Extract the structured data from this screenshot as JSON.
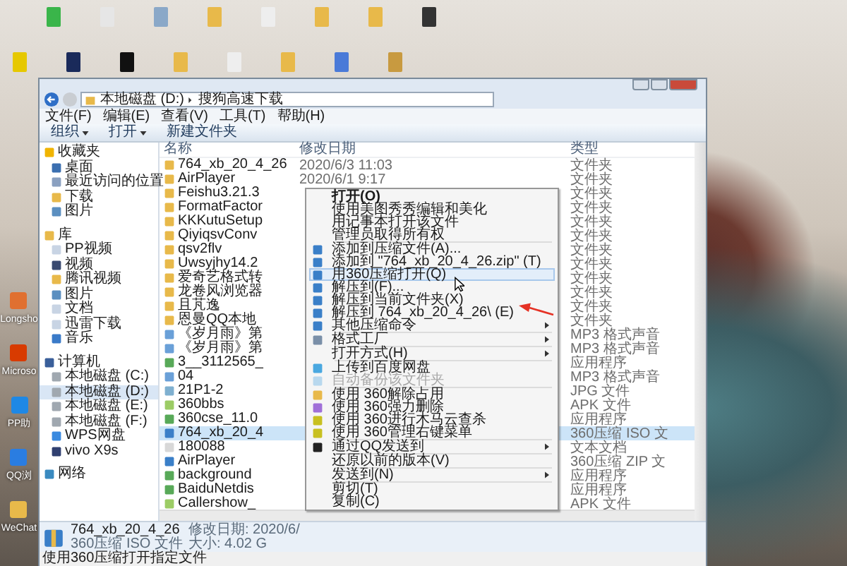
{
  "desktop": {
    "side_icons": [
      {
        "label": "Longsho"
      },
      {
        "label": "Microso"
      },
      {
        "label": "PP助"
      },
      {
        "label": "QQ浏"
      },
      {
        "label": "WeChat"
      }
    ]
  },
  "window": {
    "address": [
      "本地磁盘 (D:)",
      "搜狗高速下载"
    ],
    "menu": [
      "文件(F)",
      "编辑(E)",
      "查看(V)",
      "工具(T)",
      "帮助(H)"
    ],
    "toolbar": [
      {
        "label": "组织",
        "dropdown": true
      },
      {
        "label": "打开",
        "dropdown": true
      },
      {
        "label": "新建文件夹",
        "dropdown": false
      }
    ],
    "sidebar": [
      {
        "label": "收藏夹",
        "selected": false,
        "children": [
          {
            "label": "桌面",
            "selected": false
          },
          {
            "label": "最近访问的位置",
            "selected": false
          },
          {
            "label": "下载",
            "selected": false
          },
          {
            "label": "图片",
            "selected": false
          }
        ]
      },
      {
        "label": "库",
        "selected": false,
        "children": [
          {
            "label": "PP视频",
            "selected": false
          },
          {
            "label": "视频",
            "selected": false
          },
          {
            "label": "腾讯视频",
            "selected": false
          },
          {
            "label": "图片",
            "selected": false
          },
          {
            "label": "文档",
            "selected": false
          },
          {
            "label": "迅雷下载",
            "selected": false
          },
          {
            "label": "音乐",
            "selected": false
          }
        ]
      },
      {
        "label": "计算机",
        "selected": false,
        "children": [
          {
            "label": "本地磁盘 (C:)",
            "selected": false
          },
          {
            "label": "本地磁盘 (D:)",
            "selected": true
          },
          {
            "label": "本地磁盘 (E:)",
            "selected": false
          },
          {
            "label": "本地磁盘 (F:)",
            "selected": false
          },
          {
            "label": "WPS网盘",
            "selected": false
          },
          {
            "label": "vivo X9s",
            "selected": false
          }
        ]
      },
      {
        "label": "网络",
        "selected": false
      }
    ],
    "columns": [
      "名称",
      "修改日期",
      "类型"
    ],
    "files": [
      {
        "name": "764_xb_20_4_26",
        "date": "2020/6/3 11:03",
        "type": "文件夹",
        "kind": "folder",
        "selected": false
      },
      {
        "name": "AirPlayer",
        "date": "2020/6/1 9:17",
        "type": "文件夹",
        "kind": "folder",
        "selected": false
      },
      {
        "name": "Feishu3.21.3",
        "type": "文件夹",
        "kind": "folder",
        "selected": false
      },
      {
        "name": "FormatFactor",
        "type": "文件夹",
        "kind": "folder",
        "selected": false
      },
      {
        "name": "KKKutuSetup",
        "type": "文件夹",
        "kind": "folder",
        "selected": false
      },
      {
        "name": "QiyiqsvConv",
        "type": "文件夹",
        "kind": "folder",
        "selected": false
      },
      {
        "name": "qsv2flv",
        "type": "文件夹",
        "kind": "folder",
        "selected": false
      },
      {
        "name": "Uwsyjhy14.2",
        "type": "文件夹",
        "kind": "folder",
        "selected": false
      },
      {
        "name": "爱奇艺格式转",
        "type": "文件夹",
        "kind": "folder",
        "selected": false
      },
      {
        "name": "龙卷风浏览器",
        "type": "文件夹",
        "kind": "folder",
        "selected": false
      },
      {
        "name": "且芃逸",
        "type": "文件夹",
        "kind": "folder",
        "selected": false
      },
      {
        "name": "恩曼QQ本地",
        "type": "文件夹",
        "kind": "folder",
        "selected": false
      },
      {
        "name": "《岁月雨》第",
        "type": "MP3 格式声音",
        "kind": "audio",
        "selected": false
      },
      {
        "name": "《岁月雨》第",
        "type": "MP3 格式声音",
        "kind": "audio",
        "selected": false
      },
      {
        "name": "3__3112565_",
        "type": "应用程序",
        "kind": "app",
        "selected": false
      },
      {
        "name": "04",
        "type": "MP3 格式声音",
        "kind": "audio",
        "selected": false
      },
      {
        "name": "21P1-2",
        "type": "JPG 文件",
        "kind": "image",
        "selected": false
      },
      {
        "name": "360bbs",
        "type": "APK 文件",
        "kind": "apk",
        "selected": false
      },
      {
        "name": "360cse_11.0",
        "type": "应用程序",
        "kind": "app",
        "selected": false
      },
      {
        "name": "764_xb_20_4",
        "type": "360压缩 ISO 文",
        "kind": "archive",
        "selected": true
      },
      {
        "name": "180088",
        "type": "文本文档",
        "kind": "text",
        "selected": false
      },
      {
        "name": "AirPlayer",
        "type": "360压缩 ZIP 文",
        "kind": "archive",
        "selected": false
      },
      {
        "name": "background",
        "type": "应用程序",
        "kind": "app",
        "selected": false
      },
      {
        "name": "BaiduNetdis",
        "type": "应用程序",
        "kind": "app",
        "selected": false
      },
      {
        "name": "Callershow_",
        "type": "APK 文件",
        "kind": "apk",
        "selected": false
      }
    ],
    "details": {
      "name": "764_xb_20_4_26",
      "type": "360压缩 ISO 文件",
      "date": "修改日期: 2020/6/",
      "size": "大小: 4.02 G"
    },
    "status": "使用360压缩打开指定文件"
  },
  "context_menu": [
    {
      "kind": "item",
      "label": "打开(O)",
      "bold": true,
      "submenu": false,
      "disabled": false,
      "selected": false
    },
    {
      "kind": "item",
      "label": "使用美图秀秀编辑和美化",
      "bold": false,
      "submenu": false,
      "disabled": false,
      "selected": false
    },
    {
      "kind": "item",
      "label": "用记事本打开该文件",
      "bold": false,
      "submenu": false,
      "disabled": false,
      "selected": false
    },
    {
      "kind": "item",
      "label": "管理员取得所有权",
      "bold": false,
      "submenu": false,
      "disabled": false,
      "selected": false
    },
    {
      "kind": "separator"
    },
    {
      "kind": "item",
      "label": "添加到压缩文件(A)...",
      "bold": false,
      "submenu": false,
      "disabled": false,
      "selected": false
    },
    {
      "kind": "item",
      "label": "添加到 \"764_xb_20_4_26.zip\" (T)",
      "bold": false,
      "submenu": false,
      "disabled": false,
      "selected": false
    },
    {
      "kind": "item",
      "label": "用360压缩打开(Q)",
      "bold": false,
      "submenu": false,
      "disabled": false,
      "selected": true
    },
    {
      "kind": "item",
      "label": "解压到(F)...",
      "bold": false,
      "submenu": false,
      "disabled": false,
      "selected": false
    },
    {
      "kind": "item",
      "label": "解压到当前文件夹(X)",
      "bold": false,
      "submenu": false,
      "disabled": false,
      "selected": false
    },
    {
      "kind": "item",
      "label": "解压到 764_xb_20_4_26\\ (E)",
      "bold": false,
      "submenu": false,
      "disabled": false,
      "selected": false
    },
    {
      "kind": "item",
      "label": "其他压缩命令",
      "bold": false,
      "submenu": true,
      "disabled": false,
      "selected": false
    },
    {
      "kind": "separator"
    },
    {
      "kind": "item",
      "label": "格式工厂",
      "bold": false,
      "submenu": true,
      "disabled": false,
      "selected": false
    },
    {
      "kind": "separator"
    },
    {
      "kind": "item",
      "label": "打开方式(H)",
      "bold": false,
      "submenu": true,
      "disabled": false,
      "selected": false
    },
    {
      "kind": "separator"
    },
    {
      "kind": "item",
      "label": "上传到百度网盘",
      "bold": false,
      "submenu": false,
      "disabled": false,
      "selected": false
    },
    {
      "kind": "item",
      "label": "自动备份该文件夹",
      "bold": false,
      "submenu": false,
      "disabled": true,
      "selected": false
    },
    {
      "kind": "separator"
    },
    {
      "kind": "item",
      "label": "使用 360解除占用",
      "bold": false,
      "submenu": false,
      "disabled": false,
      "selected": false
    },
    {
      "kind": "item",
      "label": "使用 360强力删除",
      "bold": false,
      "submenu": false,
      "disabled": false,
      "selected": false
    },
    {
      "kind": "item",
      "label": "使用 360进行木马云查杀",
      "bold": false,
      "submenu": false,
      "disabled": false,
      "selected": false
    },
    {
      "kind": "item",
      "label": "使用 360管理右键菜单",
      "bold": false,
      "submenu": false,
      "disabled": false,
      "selected": false
    },
    {
      "kind": "separator"
    },
    {
      "kind": "item",
      "label": "通过QQ发送到",
      "bold": false,
      "submenu": true,
      "disabled": false,
      "selected": false
    },
    {
      "kind": "separator"
    },
    {
      "kind": "item",
      "label": "还原以前的版本(V)",
      "bold": false,
      "submenu": false,
      "disabled": false,
      "selected": false
    },
    {
      "kind": "separator"
    },
    {
      "kind": "item",
      "label": "发送到(N)",
      "bold": false,
      "submenu": true,
      "disabled": false,
      "selected": false
    },
    {
      "kind": "separator"
    },
    {
      "kind": "item",
      "label": "剪切(T)",
      "bold": false,
      "submenu": false,
      "disabled": false,
      "selected": false
    },
    {
      "kind": "item",
      "label": "复制(C)",
      "bold": false,
      "submenu": false,
      "disabled": false,
      "selected": false
    }
  ]
}
